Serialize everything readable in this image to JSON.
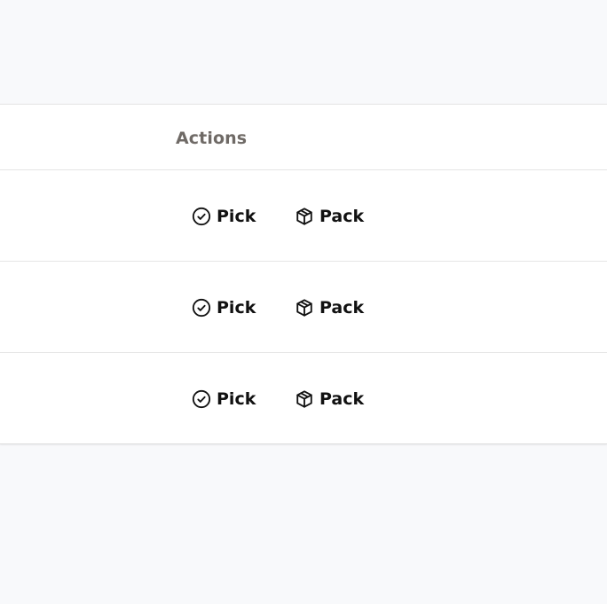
{
  "table": {
    "header": {
      "actions_label": "Actions"
    },
    "rows": [
      {
        "pick_label": "Pick",
        "pack_label": "Pack"
      },
      {
        "pick_label": "Pick",
        "pack_label": "Pack"
      },
      {
        "pick_label": "Pick",
        "pack_label": "Pack"
      }
    ]
  },
  "icons": {
    "pick": "check-circle-icon",
    "pack": "package-icon"
  },
  "colors": {
    "page_background": "#f8f9fb",
    "table_background": "#ffffff",
    "header_text": "#6f6a66",
    "action_text": "#111111",
    "divider": "#e5e5e5"
  }
}
